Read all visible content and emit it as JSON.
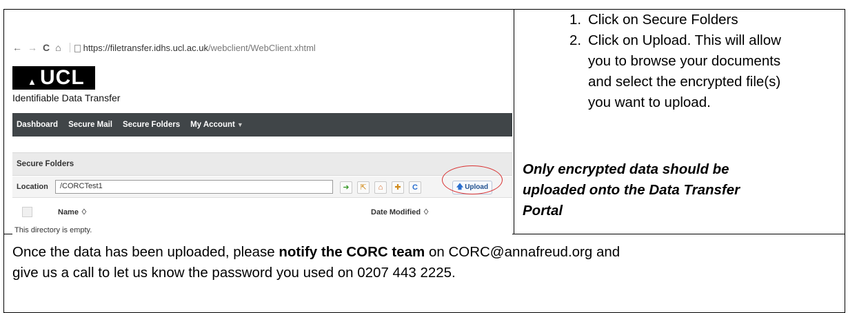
{
  "browser": {
    "back": "←",
    "forward": "→",
    "reload": "C",
    "home": "⌂",
    "url_host": "https://filetransfer.idhs.ucl.ac.uk",
    "url_path": "/webclient/WebClient.xhtml"
  },
  "app": {
    "logo_text": "UCL",
    "title": "Identifiable Data Transfer"
  },
  "navbar": {
    "items": [
      "Dashboard",
      "Secure Mail",
      "Secure Folders",
      "My Account"
    ]
  },
  "panel": {
    "title": "Secure Folders",
    "location_label": "Location",
    "location_value": "/CORCTest1",
    "upload_label": "Upload",
    "col_name": "Name ♢",
    "col_date": "Date Modified ♢",
    "empty_message": "This directory is empty."
  },
  "instructions": {
    "steps": [
      {
        "num": "1.",
        "lines": [
          "Click on Secure Folders"
        ]
      },
      {
        "num": "2.",
        "lines": [
          "Click on Upload. This will allow",
          "you to browse your documents",
          "and select the encrypted file(s)",
          "you want to upload."
        ]
      }
    ],
    "warning_lines": [
      "Only encrypted data should be",
      "uploaded onto the Data Transfer",
      "Portal"
    ]
  },
  "footer": {
    "line1_before": "Once the data has been uploaded, please ",
    "line1_bold": "notify the CORC team",
    "line1_after": " on CORC@annafreud.org and",
    "line2": "give us a call to let us know the password you used on 0207 443 2225."
  },
  "colors": {
    "navbar_bg": "#404548",
    "highlight_circle": "#d93030",
    "upload_accent": "#2a6fd0"
  }
}
